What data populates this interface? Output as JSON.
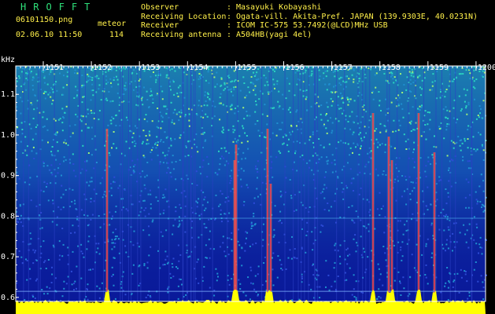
{
  "header": {
    "app_title": "HROFFT",
    "filename": "06101150.png",
    "meteor_label": "meteor",
    "datetime": "02.06.10 11:50",
    "meteor_count": "114",
    "info": [
      {
        "key": "Observer",
        "sep": ":",
        "value": "Masayuki Kobayashi"
      },
      {
        "key": "Receiving Location",
        "sep": ":",
        "value": "Ogata-vill. Akita-Pref. JAPAN (139.9303E, 40.0231N)"
      },
      {
        "key": "Receiver",
        "sep": ":",
        "value": "ICOM IC-575 53.7492(@LCD)MHz USB"
      },
      {
        "key": "Receiving antenna",
        "sep": ":",
        "value": "A504HB(yagi 4el)"
      }
    ]
  },
  "spectrogram": {
    "freq_unit": "kHz",
    "freq_ticks": [
      "1.1",
      "1.0",
      "0.9",
      "0.8",
      "0.7",
      "0.6"
    ],
    "time_ticks": [
      "1151",
      "1152",
      "1153",
      "1154",
      "1155",
      "1156",
      "1157",
      "1158",
      "1159",
      "1200"
    ],
    "colors": {
      "background": "#0a1a9a",
      "noise_mid": "#1f8fd0",
      "noise_high": "#2ad2c0",
      "meteor": "#ff2a4a",
      "meteor_glow": "#ffe040",
      "baseline": "#ffff00",
      "axis": "#ffffff",
      "header_text": "#fff04a",
      "title_text": "#2ee07a"
    }
  }
}
